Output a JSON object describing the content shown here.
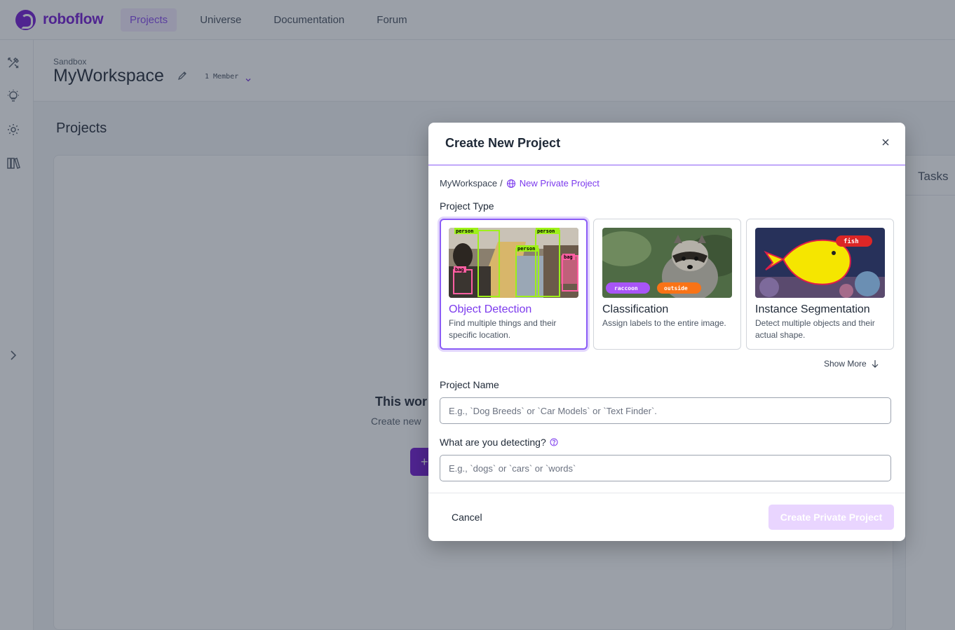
{
  "brand": {
    "name": "roboflow",
    "color": "#6706ce"
  },
  "nav": {
    "items": [
      {
        "label": "Projects",
        "active": true
      },
      {
        "label": "Universe",
        "active": false
      },
      {
        "label": "Documentation",
        "active": false
      },
      {
        "label": "Forum",
        "active": false
      }
    ]
  },
  "sidebar": {
    "icons": [
      "tools-icon",
      "lightbulb-icon",
      "gear-icon",
      "library-icon",
      "chevron-right-icon"
    ]
  },
  "workspace": {
    "plan": "Sandbox",
    "name": "MyWorkspace",
    "members": "1 Member"
  },
  "main": {
    "heading": "Projects",
    "empty_title": "This wor",
    "empty_sub": "Create new",
    "add_button": "+",
    "tasks_label": "Tasks"
  },
  "modal": {
    "title": "Create New Project",
    "breadcrumb": {
      "workspace": "MyWorkspace",
      "separator": "/",
      "project": "New Private Project"
    },
    "project_type_label": "Project Type",
    "types": [
      {
        "title": "Object Detection",
        "desc": "Find multiple things and their specific location.",
        "selected": true,
        "tags": [
          "person",
          "person",
          "person",
          "bag",
          "bag"
        ]
      },
      {
        "title": "Classification",
        "desc": "Assign labels to the entire image.",
        "selected": false,
        "tags": [
          "raccoon",
          "outside"
        ]
      },
      {
        "title": "Instance Segmentation",
        "desc": "Detect multiple objects and their actual shape.",
        "selected": false,
        "tags": [
          "fish"
        ]
      }
    ],
    "show_more": "Show More",
    "project_name": {
      "label": "Project Name",
      "placeholder": "E.g., `Dog Breeds` or `Car Models` or `Text Finder`.",
      "value": ""
    },
    "detecting": {
      "label": "What are you detecting?",
      "placeholder": "E.g., `dogs` or `cars` or `words`",
      "value": ""
    },
    "cancel": "Cancel",
    "create": "Create Private Project",
    "create_disabled": true
  },
  "colors": {
    "accent": "#7c3aed",
    "accent_light": "#e9d5ff",
    "selected_border": "#8b5cf6"
  }
}
